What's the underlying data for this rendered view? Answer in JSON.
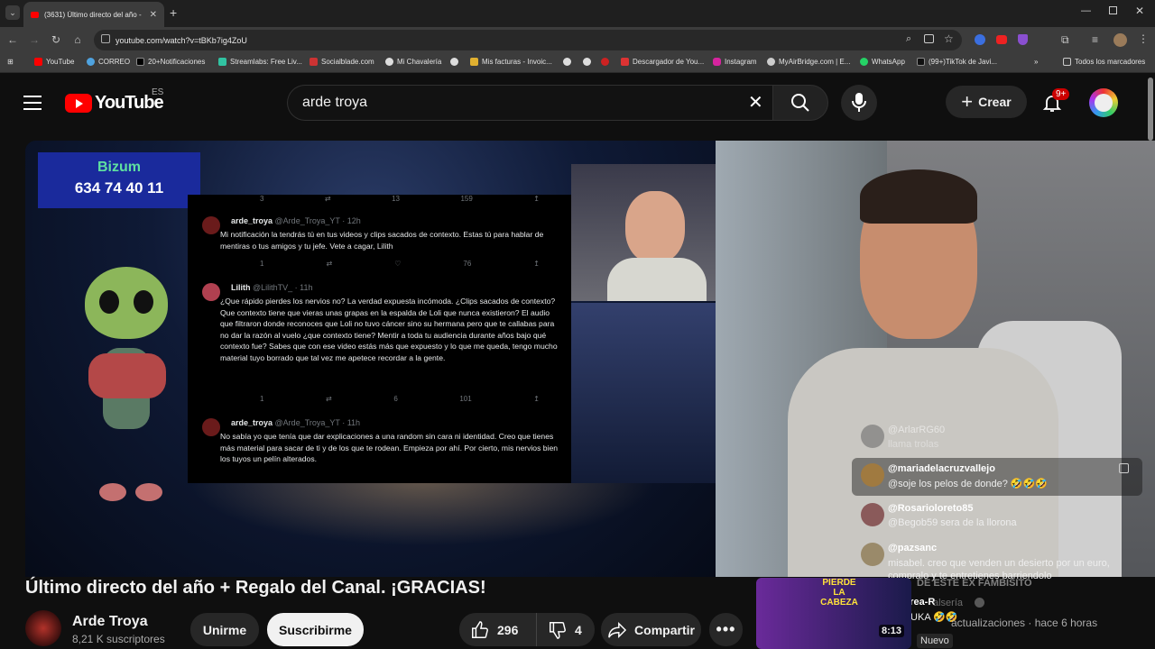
{
  "browser": {
    "tab_title": "(3631) Último directo del año -",
    "url": "youtube.com/watch?v=tBKb7ig4ZoU",
    "bookmarks": [
      "YouTube",
      "CORREO",
      "20+Notificaciones",
      "Streamlabs: Free Liv...",
      "Socialblade.com",
      "Mi Chavalería",
      "Mis facturas - Invoic...",
      "Descargador de You...",
      "Instagram",
      "MyAirBridge.com | E...",
      "WhatsApp",
      "(99+)TikTok de Javi..."
    ],
    "all_bookmarks": "Todos los marcadores"
  },
  "header": {
    "logo_text": "YouTube",
    "country": "ES",
    "search_value": "arde troya",
    "create_label": "Crear",
    "notif_count": "9+"
  },
  "video": {
    "bizum_label": "Bizum",
    "bizum_number": "634 74 40 11",
    "tweets": [
      {
        "user": "arde_troya",
        "handle": "@Arde_Troya_YT · 12h",
        "text": "Mi notificación la tendrás tú en tus videos y clips sacados de contexto. Estas tú para hablar de mentiras o tus amigos y tu jefe. Vete a cagar, Lilith",
        "replies": "1",
        "likes": "",
        "views": "76"
      },
      {
        "user": "Lilith",
        "handle": "@LilithTV_ · 11h",
        "text": "¿Que rápido pierdes los nervios no? La verdad expuesta incómoda. ¿Clips sacados de contexto? Que contexto tiene que vieras unas grapas en la espalda de Loli que nunca existieron? El audio que filtraron donde reconoces que Loli no tuvo cáncer sino su hermana pero que te callabas para no dar la razón al vuelo ¿que contexto tiene? Mentir a toda tu audiencia durante años bajo qué contexto fue? Sabes que con ese video estás más que expuesto y lo que me queda, tengo mucho material tuyo borrado que tal vez me apetece recordar a la gente.",
        "replies": "1",
        "likes": "6",
        "views": "101"
      },
      {
        "user": "arde_troya",
        "handle": "@Arde_Troya_YT · 11h",
        "text": "No sabía yo que tenía que dar explicaciones a una random sin cara ni identidad. Creo que tienes más material para sacar de ti y de los que te rodean. Empieza por ahí. Por cierto, mis nervios bien los tuyos un pelín alterados.",
        "replies": "",
        "likes": "",
        "views": ""
      }
    ],
    "top_actions": {
      "replies": "3",
      "likes": "13",
      "views": "159"
    }
  },
  "chat": {
    "faded_user": "@ArlarRG60",
    "faded_text": "llama trolas",
    "messages": [
      {
        "user": "@mariadelacruzvallejo",
        "text": "@soje los pelos de donde? 🤣🤣🤣"
      },
      {
        "user": "@Rosarioloreto85",
        "text": "@Begob59 sera de la llorona"
      },
      {
        "user": "@pazsanc",
        "text": "misabel. creo que venden un desierto por un euro, compralo y te entretienes barriendolo"
      },
      {
        "user": "@Lorea-R",
        "text": "SHIZUKA 🤣🤣"
      }
    ]
  },
  "related": {
    "thumb_text": "PIERDE LA CABEZA",
    "title_fragment": "DE ESTE EX FAMBISITO",
    "channel_fragment": "alsería",
    "meta": "actualizaciones · hace 6 horas",
    "duration": "8:13",
    "badge": "Nuevo"
  },
  "below": {
    "title": "Último directo del año + Regalo del Canal. ¡GRACIAS!",
    "channel_name": "Arde Troya",
    "subscribers": "8,21 K suscriptores",
    "join_label": "Unirme",
    "subscribe_label": "Suscribirme",
    "likes": "296",
    "dislikes": "4",
    "share_label": "Compartir"
  },
  "colors": {
    "accent": "#ff0000",
    "bg": "#0f0f0f",
    "pill": "#272727",
    "bizum": "#1a2a9c"
  }
}
